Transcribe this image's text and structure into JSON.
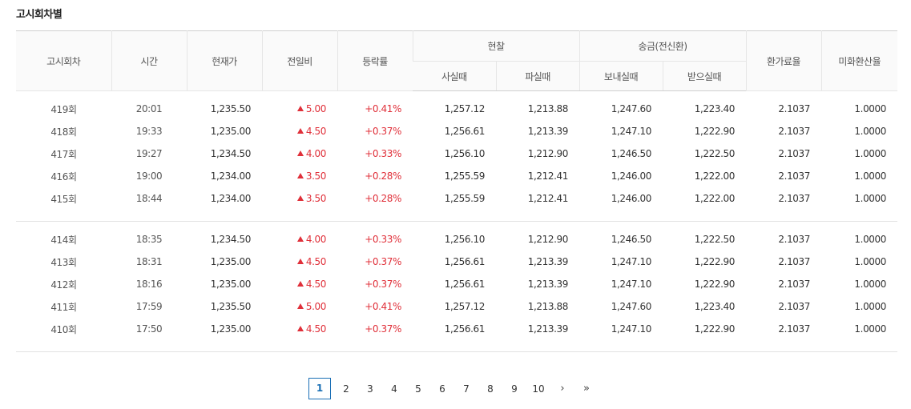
{
  "page_title": "고시회차별",
  "headers": {
    "round": "고시회차",
    "time": "시간",
    "current": "현재가",
    "change": "전일비",
    "change_rate": "등락률",
    "cash": "현찰",
    "cash_buy": "사실때",
    "cash_sell": "파실때",
    "remit": "송금(전신환)",
    "remit_send": "보내실때",
    "remit_receive": "받으실때",
    "fx_rate": "환가료율",
    "usd_rate": "미화환산율"
  },
  "groups": [
    [
      {
        "round": "419회",
        "time": "20:01",
        "current": "1,235.50",
        "change": "5.00",
        "rate": "+0.41%",
        "cash_buy": "1,257.12",
        "cash_sell": "1,213.88",
        "send": "1,247.60",
        "receive": "1,223.40",
        "fx": "2.1037",
        "usd": "1.0000"
      },
      {
        "round": "418회",
        "time": "19:33",
        "current": "1,235.00",
        "change": "4.50",
        "rate": "+0.37%",
        "cash_buy": "1,256.61",
        "cash_sell": "1,213.39",
        "send": "1,247.10",
        "receive": "1,222.90",
        "fx": "2.1037",
        "usd": "1.0000"
      },
      {
        "round": "417회",
        "time": "19:27",
        "current": "1,234.50",
        "change": "4.00",
        "rate": "+0.33%",
        "cash_buy": "1,256.10",
        "cash_sell": "1,212.90",
        "send": "1,246.50",
        "receive": "1,222.50",
        "fx": "2.1037",
        "usd": "1.0000"
      },
      {
        "round": "416회",
        "time": "19:00",
        "current": "1,234.00",
        "change": "3.50",
        "rate": "+0.28%",
        "cash_buy": "1,255.59",
        "cash_sell": "1,212.41",
        "send": "1,246.00",
        "receive": "1,222.00",
        "fx": "2.1037",
        "usd": "1.0000"
      },
      {
        "round": "415회",
        "time": "18:44",
        "current": "1,234.00",
        "change": "3.50",
        "rate": "+0.28%",
        "cash_buy": "1,255.59",
        "cash_sell": "1,212.41",
        "send": "1,246.00",
        "receive": "1,222.00",
        "fx": "2.1037",
        "usd": "1.0000"
      }
    ],
    [
      {
        "round": "414회",
        "time": "18:35",
        "current": "1,234.50",
        "change": "4.00",
        "rate": "+0.33%",
        "cash_buy": "1,256.10",
        "cash_sell": "1,212.90",
        "send": "1,246.50",
        "receive": "1,222.50",
        "fx": "2.1037",
        "usd": "1.0000"
      },
      {
        "round": "413회",
        "time": "18:31",
        "current": "1,235.00",
        "change": "4.50",
        "rate": "+0.37%",
        "cash_buy": "1,256.61",
        "cash_sell": "1,213.39",
        "send": "1,247.10",
        "receive": "1,222.90",
        "fx": "2.1037",
        "usd": "1.0000"
      },
      {
        "round": "412회",
        "time": "18:16",
        "current": "1,235.00",
        "change": "4.50",
        "rate": "+0.37%",
        "cash_buy": "1,256.61",
        "cash_sell": "1,213.39",
        "send": "1,247.10",
        "receive": "1,222.90",
        "fx": "2.1037",
        "usd": "1.0000"
      },
      {
        "round": "411회",
        "time": "17:59",
        "current": "1,235.50",
        "change": "5.00",
        "rate": "+0.41%",
        "cash_buy": "1,257.12",
        "cash_sell": "1,213.88",
        "send": "1,247.60",
        "receive": "1,223.40",
        "fx": "2.1037",
        "usd": "1.0000"
      },
      {
        "round": "410회",
        "time": "17:50",
        "current": "1,235.00",
        "change": "4.50",
        "rate": "+0.37%",
        "cash_buy": "1,256.61",
        "cash_sell": "1,213.39",
        "send": "1,247.10",
        "receive": "1,222.90",
        "fx": "2.1037",
        "usd": "1.0000"
      }
    ]
  ],
  "change_direction_icon": "up-triangle-icon",
  "colors": {
    "up": "#e0303a",
    "active_page": "#1a6fb5"
  },
  "pagination": {
    "pages": [
      "1",
      "2",
      "3",
      "4",
      "5",
      "6",
      "7",
      "8",
      "9",
      "10"
    ],
    "current": "1",
    "next": "›",
    "last": "»"
  }
}
